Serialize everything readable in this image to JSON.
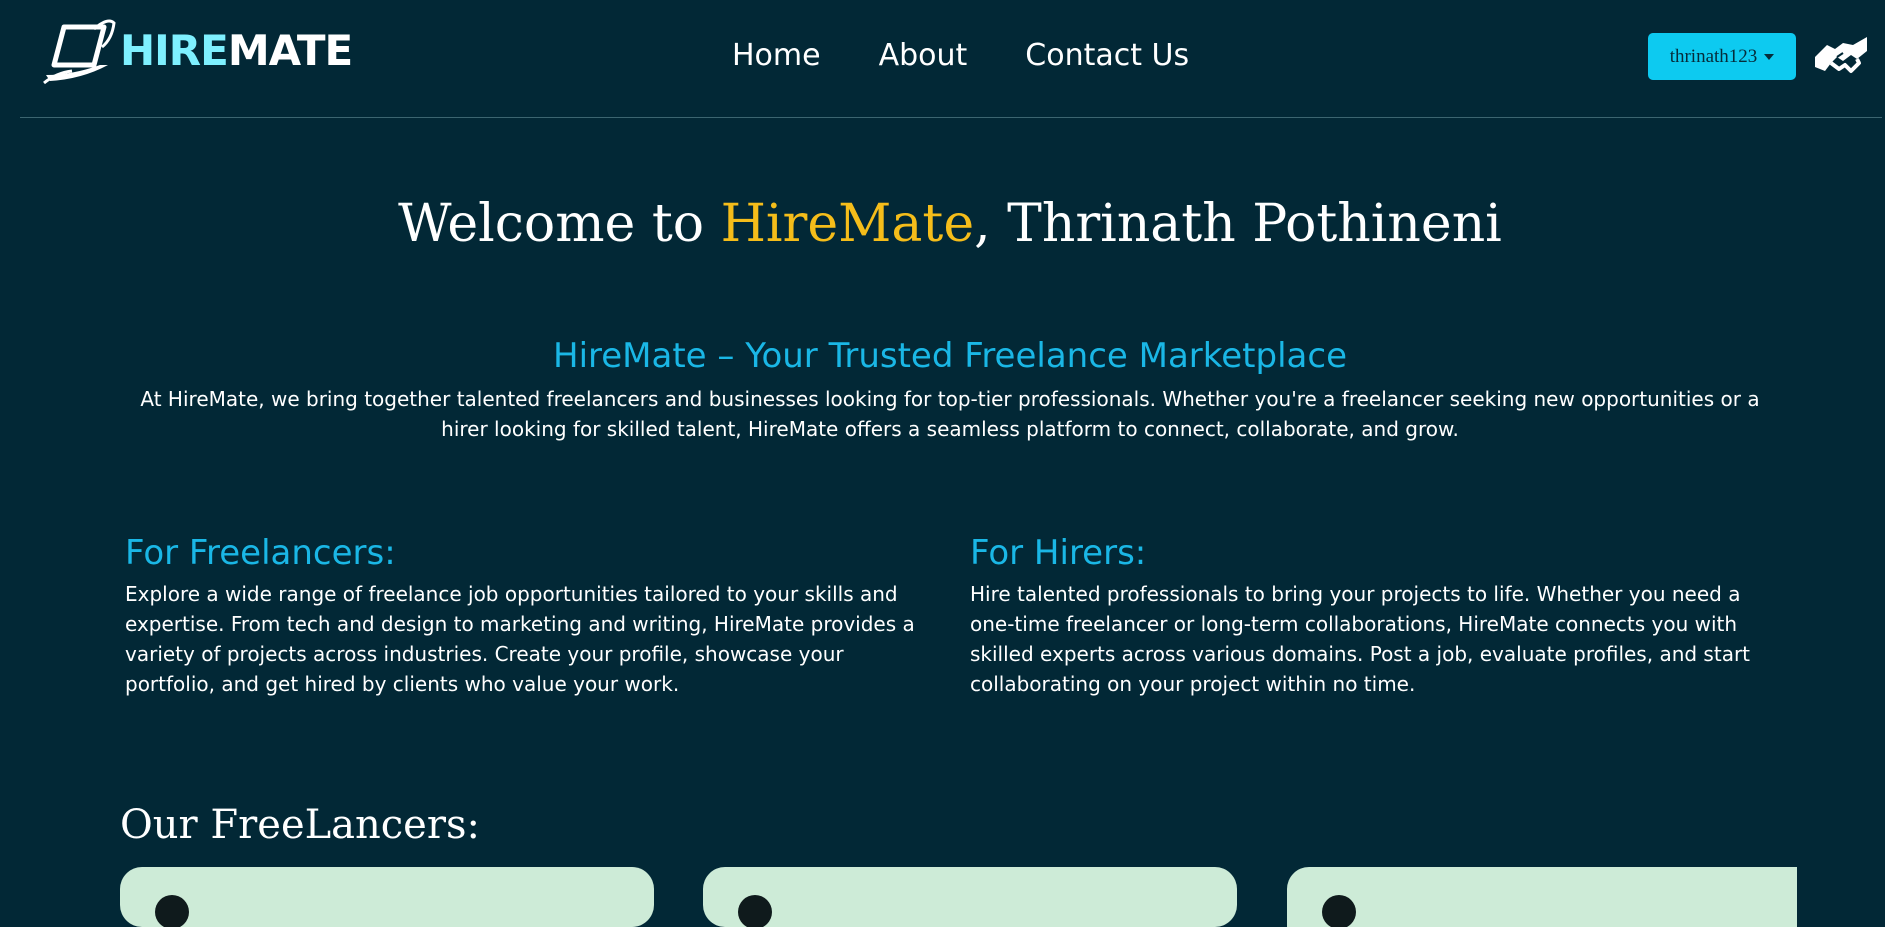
{
  "header": {
    "logo": {
      "hire": "HIRE",
      "mate": "MATE"
    },
    "nav": [
      {
        "label": "Home"
      },
      {
        "label": "About"
      },
      {
        "label": "Contact Us"
      }
    ],
    "user_menu": {
      "username": "thrinath123"
    },
    "handshake_icon": "handshake-icon"
  },
  "hero": {
    "welcome_prefix": "Welcome to ",
    "brand": "HireMate",
    "welcome_suffix": ", Thrinath Pothineni"
  },
  "about": {
    "tagline": "HireMate – Your Trusted Freelance Marketplace",
    "intro": "At HireMate, we bring together talented freelancers and businesses looking for top-tier professionals. Whether you're a freelancer seeking new opportunities or a hirer looking for skilled talent, HireMate offers a seamless platform to connect, collaborate, and grow."
  },
  "freelancers": {
    "title": "For Freelancers:",
    "body": "Explore a wide range of freelance job opportunities tailored to your skills and expertise. From tech and design to marketing and writing, HireMate provides a variety of projects across industries. Create your profile, showcase your portfolio, and get hired by clients who value your work."
  },
  "hirers": {
    "title": "For Hirers:",
    "body": "Hire talented professionals to bring your projects to life. Whether you need a one-time freelancer or long-term collaborations, HireMate connects you with skilled experts across various domains. Post a job, evaluate profiles, and start collaborating on your project within no time."
  },
  "our_freelancers": {
    "title": "Our FreeLancers:"
  },
  "colors": {
    "background": "#022836",
    "accent_cyan": "#1ab7e6",
    "brand_yellow": "#f5bd1a",
    "button": "#0dcaf0",
    "card": "#cdebd7"
  }
}
